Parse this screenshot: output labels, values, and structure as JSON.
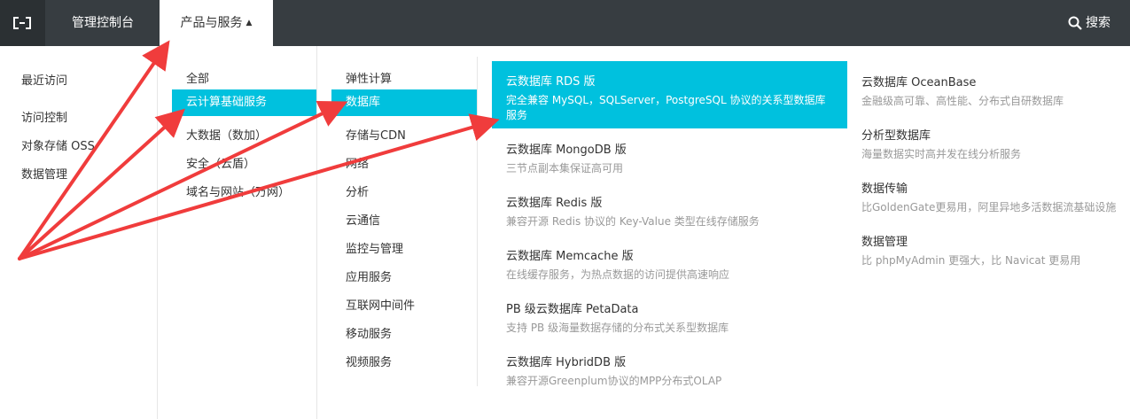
{
  "topbar": {
    "console_label": "管理控制台",
    "products_label": "产品与服务",
    "products_caret": "▲",
    "search_label": "搜索"
  },
  "col1": {
    "recent": "最近访问",
    "items": [
      "访问控制",
      "对象存储 OSS",
      "数据管理"
    ]
  },
  "col2": {
    "items": [
      "全部",
      "云计算基础服务",
      "大数据（数加）",
      "安全（云盾）",
      "域名与网站（万网）"
    ]
  },
  "col3": {
    "items": [
      "弹性计算",
      "数据库",
      "存储与CDN",
      "网络",
      "分析",
      "云通信",
      "监控与管理",
      "应用服务",
      "互联网中间件",
      "移动服务",
      "视频服务"
    ]
  },
  "services_left": [
    {
      "title": "云数据库 RDS 版",
      "desc": "完全兼容 MySQL，SQLServer，PostgreSQL 协议的关系型数据库服务"
    },
    {
      "title": "云数据库 MongoDB 版",
      "desc": "三节点副本集保证高可用"
    },
    {
      "title": "云数据库 Redis 版",
      "desc": "兼容开源 Redis 协议的 Key-Value 类型在线存储服务"
    },
    {
      "title": "云数据库 Memcache 版",
      "desc": "在线缓存服务，为热点数据的访问提供高速响应"
    },
    {
      "title": "PB 级云数据库 PetaData",
      "desc": "支持 PB 级海量数据存储的分布式关系型数据库"
    },
    {
      "title": "云数据库 HybridDB 版",
      "desc": "兼容开源Greenplum协议的MPP分布式OLAP"
    }
  ],
  "services_right": [
    {
      "title": "云数据库 OceanBase",
      "desc": "金融级高可靠、高性能、分布式自研数据库"
    },
    {
      "title": "分析型数据库",
      "desc": "海量数据实时高并发在线分析服务"
    },
    {
      "title": "数据传输",
      "desc": "比GoldenGate更易用，阿里异地多活数据流基础设施"
    },
    {
      "title": "数据管理",
      "desc": "比 phpMyAdmin 更强大，比 Navicat 更易用"
    }
  ],
  "colors": {
    "topbar": "#373d41",
    "active": "#00c1de",
    "annotation_arrow": "#f03c3c"
  }
}
